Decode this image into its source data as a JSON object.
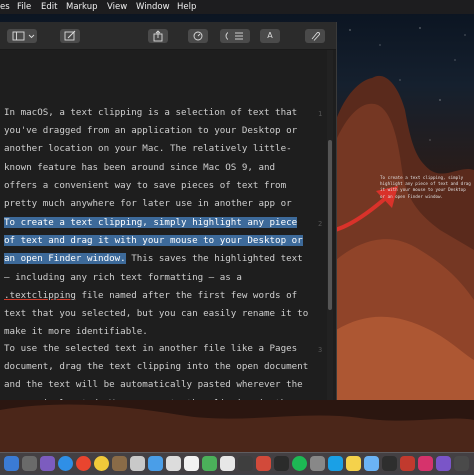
{
  "menubar": {
    "app_fragment": "es",
    "items": [
      "File",
      "Edit",
      "Markup",
      "View",
      "Window",
      "Help"
    ]
  },
  "toolbar": {
    "buttons": [
      "sidebar-icon",
      "pencil-icon",
      "share-icon",
      "rotate-icon",
      "info-icon",
      "list-icon",
      "text-A-icon",
      "paperclip-icon"
    ],
    "text_tool_label": "A"
  },
  "document": {
    "paragraphs": [
      {
        "plain_before": "In macOS, a text clipping is a selection of text that you've dragged from an application to your Desktop or another location on your Mac. The relatively little-known feature has been around since Mac OS 9, and offers a convenient way to save pieces of text from pretty much anywhere for later use in another app or document.",
        "line_number": "1"
      },
      {
        "highlighted": "To create a text clipping, simply highlight any piece of text and drag it with your mouse to your Desktop or an open Finder window.",
        "after_1": " This saves the highlighted text – including any rich text formatting – as a ",
        "underlined": ".textclipping",
        "after_2": " file named after the first few words of text that you selected, but you can easily rename it to make it more identifiable.",
        "line_number": "2"
      },
      {
        "plain_before": "To use the selected text in another file like a Pages document, drag the text clipping into the open document and the text will be automatically pasted wherever the cursor is located. You can paste the clipping in the same way into all sorts of open apps, including web browsers, Mail compose windows, Xcode projects, and more.",
        "line_number": "3"
      }
    ]
  },
  "desktop_clipping": {
    "text": "To create a text clipping, simply highlight any piece of text and drag it with your mouse to your Desktop or an open Finder window."
  },
  "colors": {
    "selection": "#3d6a9a",
    "arrow": "#d9322a"
  }
}
